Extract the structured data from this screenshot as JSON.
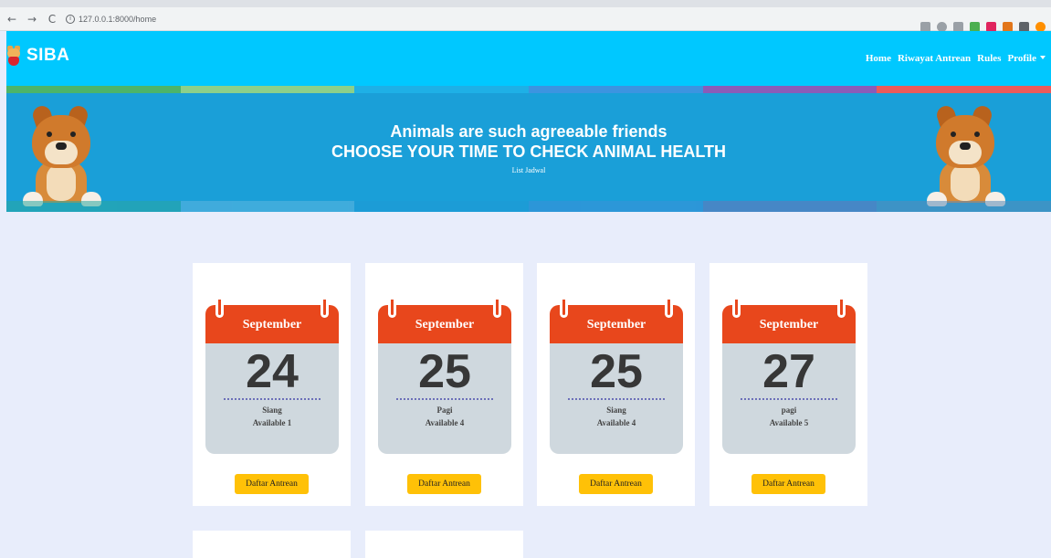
{
  "browser": {
    "url": "127.0.0.1:8000/home"
  },
  "navbar": {
    "brand": "SIBA",
    "links": [
      "Home",
      "Riwayat Antrean",
      "Rules",
      "Profile"
    ]
  },
  "banner": {
    "line1": "Animals are such agreeable friends",
    "line2": "CHOOSE YOUR TIME TO CHECK ANIMAL HEALTH",
    "line3": "List Jadwal"
  },
  "schedules": [
    {
      "month": "September",
      "day": "24",
      "session": "Siang",
      "available": "Available 1",
      "button": "Daftar Antrean"
    },
    {
      "month": "September",
      "day": "25",
      "session": "Pagi",
      "available": "Available 4",
      "button": "Daftar Antrean"
    },
    {
      "month": "September",
      "day": "25",
      "session": "Siang",
      "available": "Available 4",
      "button": "Daftar Antrean"
    },
    {
      "month": "September",
      "day": "27",
      "session": "pagi",
      "available": "Available 5",
      "button": "Daftar Antrean"
    }
  ],
  "colors": {
    "navbar": "#00c8ff",
    "banner": "#1a9fd8",
    "calendar_header": "#e8471c",
    "calendar_body": "#cfd8de",
    "button": "#ffc107",
    "page_background": "#e8edfb"
  }
}
